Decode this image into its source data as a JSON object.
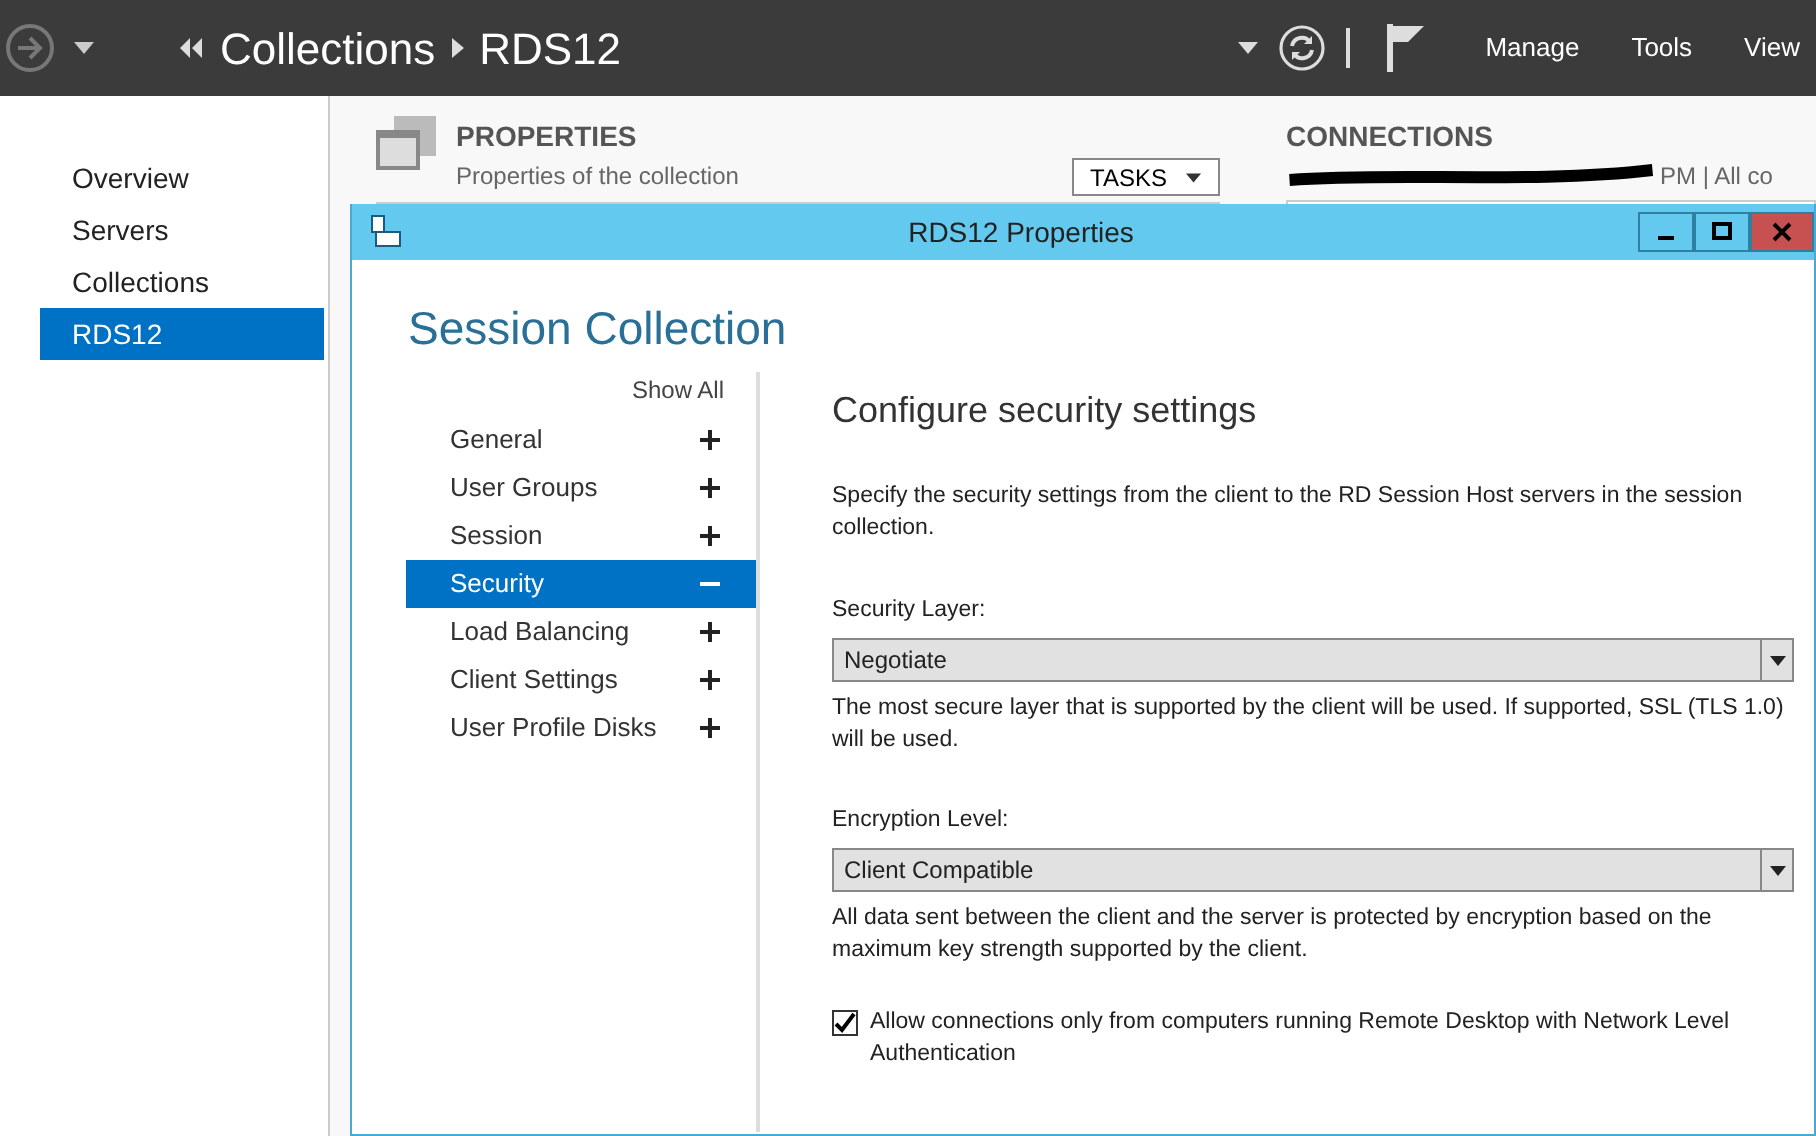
{
  "topbar": {
    "breadcrumb": [
      "Collections",
      "RDS12"
    ],
    "menu": [
      "Manage",
      "Tools",
      "View"
    ]
  },
  "sidebar": {
    "items": [
      {
        "label": "Overview",
        "selected": false
      },
      {
        "label": "Servers",
        "selected": false
      },
      {
        "label": "Collections",
        "selected": false
      },
      {
        "label": "RDS12",
        "selected": true
      }
    ]
  },
  "properties_panel": {
    "title": "PROPERTIES",
    "subtitle": "Properties of the collection",
    "tasks_button": "TASKS"
  },
  "connections_panel": {
    "title": "CONNECTIONS",
    "subtitle": "PM | All co"
  },
  "dialog": {
    "title": "RDS12 Properties",
    "heading": "Session Collection",
    "show_all": "Show All",
    "nav": [
      {
        "label": "General",
        "selected": false,
        "expanded": false
      },
      {
        "label": "User Groups",
        "selected": false,
        "expanded": false
      },
      {
        "label": "Session",
        "selected": false,
        "expanded": false
      },
      {
        "label": "Security",
        "selected": true,
        "expanded": true
      },
      {
        "label": "Load Balancing",
        "selected": false,
        "expanded": false
      },
      {
        "label": "Client Settings",
        "selected": false,
        "expanded": false
      },
      {
        "label": "User Profile Disks",
        "selected": false,
        "expanded": false
      }
    ],
    "section_title": "Configure security settings",
    "description": "Specify the security settings from the client to the RD Session Host servers in the session collection.",
    "fields": [
      {
        "label": "Security Layer:",
        "value": "Negotiate",
        "note": "The most secure layer that is supported by the client will be used. If supported, SSL (TLS 1.0) will be used."
      },
      {
        "label": "Encryption Level:",
        "value": "Client Compatible",
        "note": "All data sent between the client and the server is protected by encryption based on the maximum key strength supported by the client."
      }
    ],
    "checkbox": {
      "label": "Allow connections only from computers running Remote Desktop with Network Level Authentication",
      "checked": true
    }
  }
}
